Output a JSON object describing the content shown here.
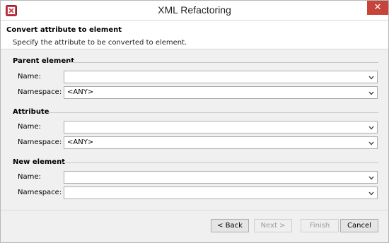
{
  "window": {
    "title": "XML Refactoring",
    "close_glyph": "✕",
    "app_icon": "xml-refactor-icon"
  },
  "banner": {
    "title": "Convert attribute to element",
    "description": "Specify the attribute to be converted to element."
  },
  "groups": {
    "parent": {
      "header": "Parent element",
      "name_label": "Name:",
      "name_value": "",
      "namespace_label": "Namespace:",
      "namespace_value": "<ANY>"
    },
    "attribute": {
      "header": "Attribute",
      "name_label": "Name:",
      "name_value": "",
      "namespace_label": "Namespace:",
      "namespace_value": "<ANY>"
    },
    "new_element": {
      "header": "New element",
      "name_label": "Name:",
      "name_value": "",
      "namespace_label": "Namespace:",
      "namespace_value": ""
    }
  },
  "buttons": {
    "back": "< Back",
    "next": "Next >",
    "finish": "Finish",
    "cancel": "Cancel"
  },
  "icons": {
    "dropdown": "chevron-down-icon"
  }
}
